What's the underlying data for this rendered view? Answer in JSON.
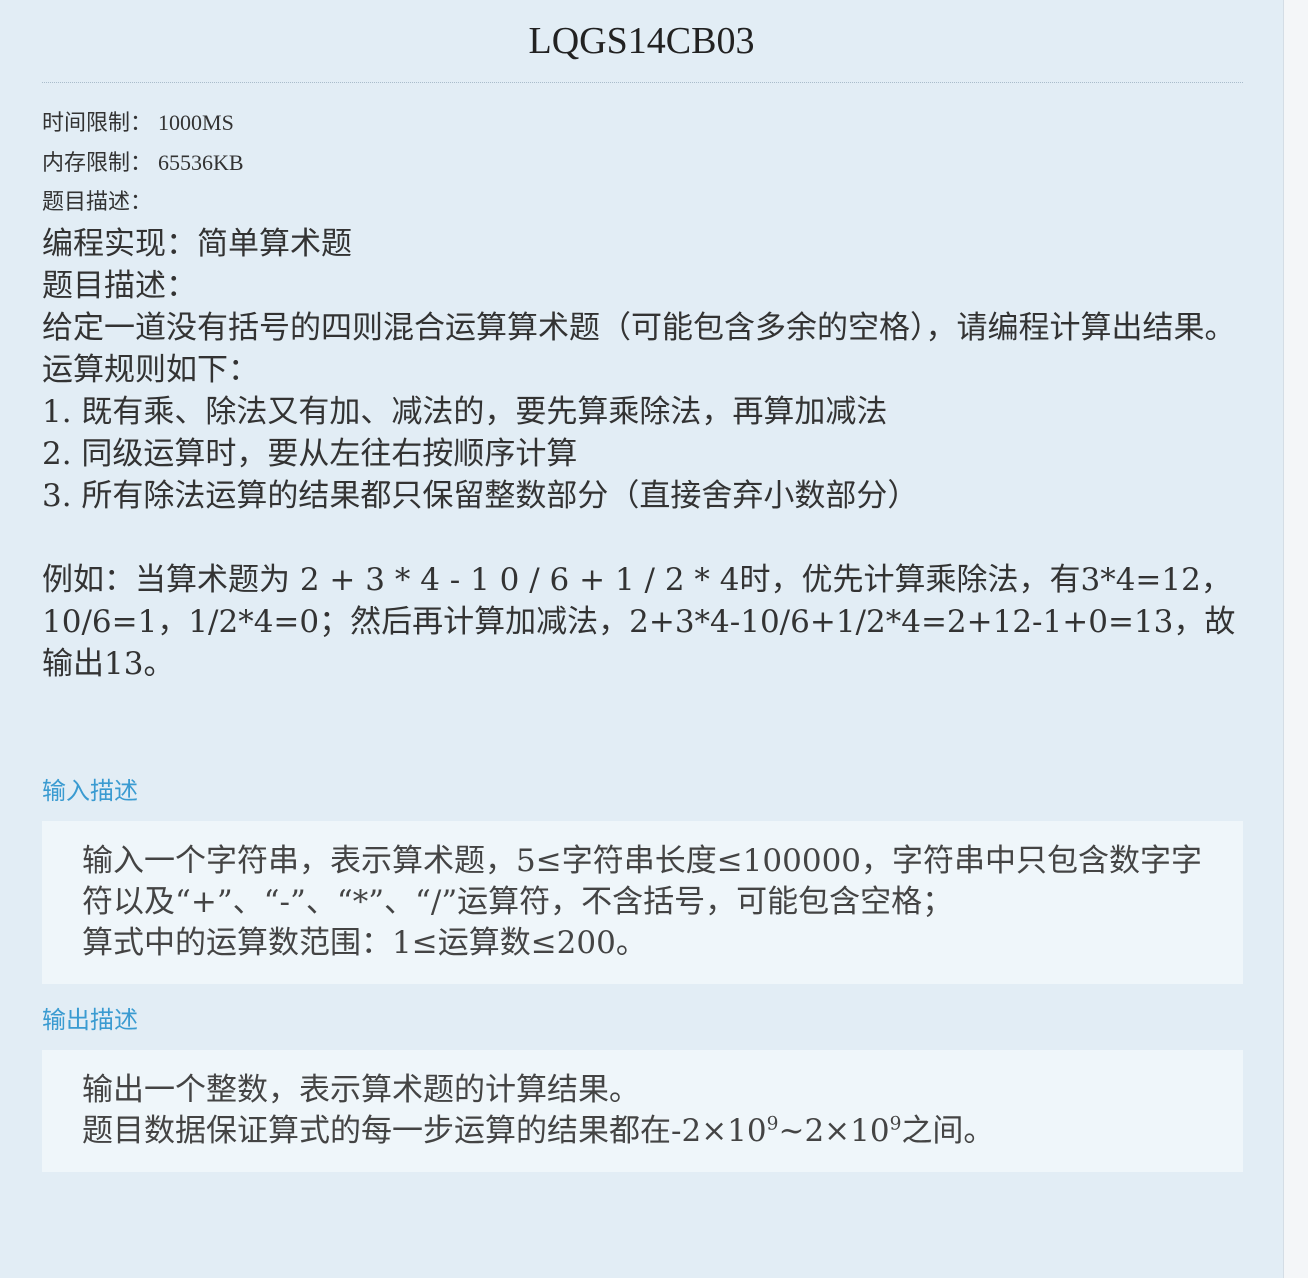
{
  "title": "LQGS14CB03",
  "meta": {
    "time_limit_label": "时间限制：",
    "time_limit_value": "1000MS",
    "memory_limit_label": "内存限制：",
    "memory_limit_value": "65536KB",
    "description_label": "题目描述："
  },
  "description": {
    "lines": [
      "编程实现：简单算术题",
      "题目描述：",
      "给定一道没有括号的四则混合运算算术题（可能包含多余的空格），请编程计算出结果。",
      "运算规则如下：",
      "1. 既有乘、除法又有加、减法的，要先算乘除法，再算加减法",
      "2. 同级运算时，要从左往右按顺序计算",
      "3. 所有除法运算的结果都只保留整数部分（直接舍弃小数部分）",
      "",
      "例如：当算术题为 2 + 3 * 4 - 1 0 / 6 + 1 / 2 * 4时，优先计算乘除法，有3*4=12，10/6=1，1/2*4=0；然后再计算加减法，2+3*4-10/6+1/2*4=2+12-1+0=13，故输出13。"
    ]
  },
  "input_section": {
    "label": "输入描述",
    "lines": [
      "输入一个字符串，表示算术题，5≤字符串长度≤100000，字符串中只包含数字字符以及“+”、“-”、“*”、“/”运算符，不含括号，可能包含空格；",
      "算式中的运算数范围：1≤运算数≤200。"
    ]
  },
  "output_section": {
    "label": "输出描述",
    "line1": "输出一个整数，表示算术题的计算结果。",
    "line2_prefix": "题目数据保证算式的每一步运算的结果都在-2×10",
    "line2_exp1": "9",
    "line2_mid": "~2×10",
    "line2_exp2": "9",
    "line2_suffix": "之间。"
  }
}
